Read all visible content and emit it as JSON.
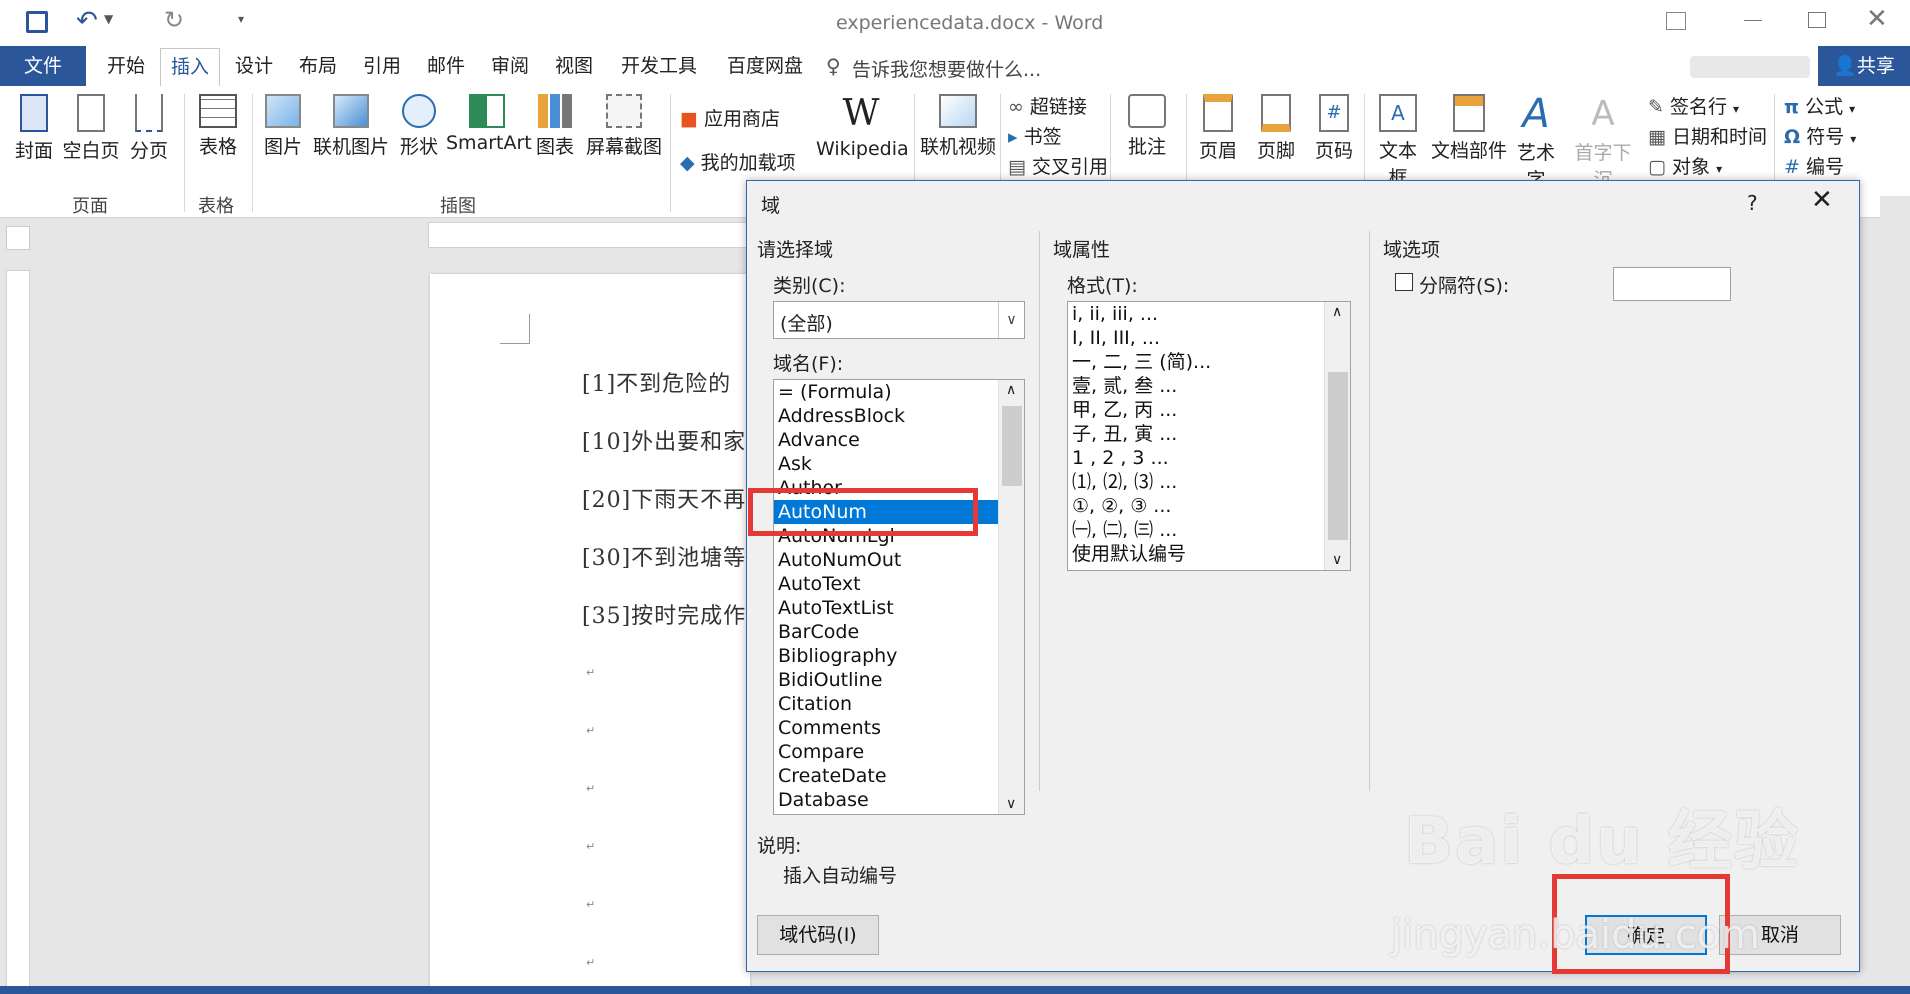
{
  "title": "experiencedata.docx - Word",
  "tabs": [
    "文件",
    "开始",
    "插入",
    "设计",
    "布局",
    "引用",
    "邮件",
    "审阅",
    "视图",
    "开发工具",
    "百度网盘"
  ],
  "tellme": "告诉我您想要做什么...",
  "share": "共享",
  "ribbon": {
    "cover": "封面",
    "blank": "空白页",
    "pagebreak": "分页",
    "table": "表格",
    "picture": "图片",
    "online_picture": "联机图片",
    "shapes": "形状",
    "smartart": "SmartArt",
    "chart": "图表",
    "screenshot": "屏幕截图",
    "store": "应用商店",
    "my_addins": "我的加载项",
    "wikipedia": "Wikipedia",
    "online_video": "联机视频",
    "hyperlink": "超链接",
    "bookmark": "书签",
    "crossref": "交叉引用",
    "comment": "批注",
    "header": "页眉",
    "footer": "页脚",
    "pagenum": "页码",
    "textbox": "文本框",
    "quickparts": "文档部件",
    "wordart": "艺术字",
    "dropcap": "首字下沉",
    "signature": "签名行",
    "datetime": "日期和时间",
    "object": "对象",
    "equation": "公式",
    "symbol": "符号",
    "number": "编号",
    "groups": {
      "pages": "页面",
      "tables": "表格",
      "illustrations": "插图"
    }
  },
  "document": {
    "lines": [
      "[1]不到危险的",
      "[10]外出要和家",
      "[20]下雨天不再",
      "[30]不到池塘等",
      "[35]按时完成作"
    ]
  },
  "dialog": {
    "title": "域",
    "help": "?",
    "choose": "请选择域",
    "category_label": "类别(C):",
    "category_value": "(全部)",
    "field_names_label": "域名(F):",
    "field_names": [
      "= (Formula)",
      "AddressBlock",
      "Advance",
      "Ask",
      "Author",
      "AutoNum",
      "AutoNumLgl",
      "AutoNumOut",
      "AutoText",
      "AutoTextList",
      "BarCode",
      "Bibliography",
      "BidiOutline",
      "Citation",
      "Comments",
      "Compare",
      "CreateDate",
      "Database"
    ],
    "selected_field": "AutoNum",
    "props_title": "域属性",
    "format_label": "格式(T):",
    "formats": [
      "i, ii, iii, ...",
      "I, II, III, ...",
      "一, 二, 三 (简)...",
      "壹, 贰, 叁 ...",
      "甲, 乙, 丙 ...",
      "子, 丑, 寅 ...",
      "1 , 2 , 3  ...",
      "⑴, ⑵, ⑶ ...",
      "①, ②, ③ ...",
      "㈠, ㈡, ㈢ ...",
      "使用默认编号"
    ],
    "options_title": "域选项",
    "separator_label": "分隔符(S):",
    "desc_label": "说明:",
    "desc_text": "插入自动编号",
    "field_codes": "域代码(I)",
    "ok": "确定",
    "cancel": "取消"
  },
  "watermark": {
    "brand": "Bai du 经验",
    "url": "jingyan.baidu.com"
  }
}
